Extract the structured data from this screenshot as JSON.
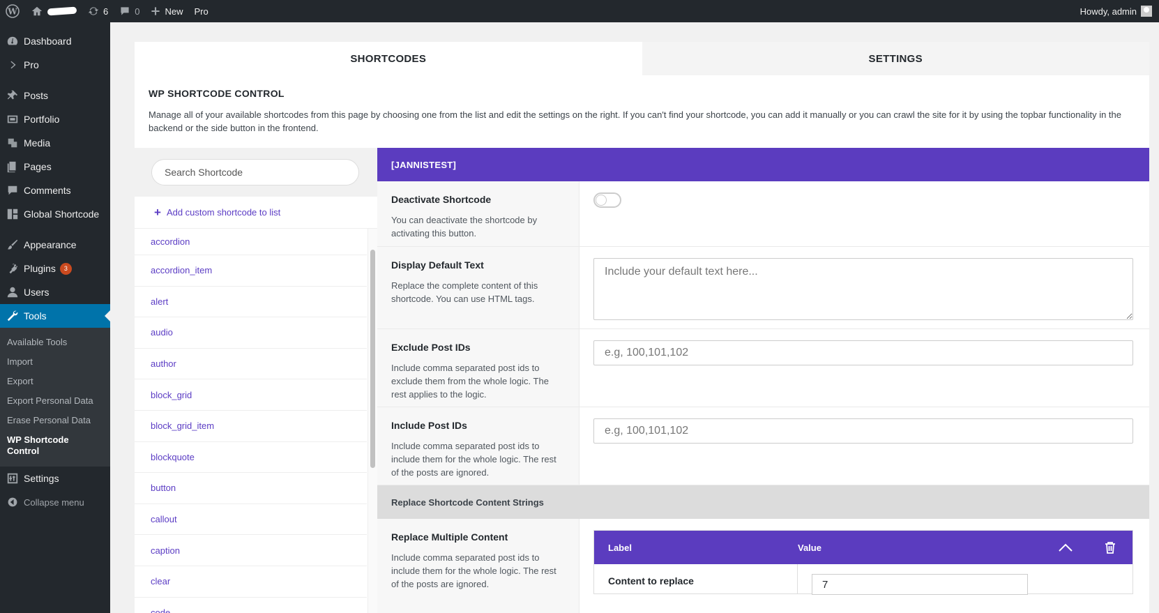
{
  "adminbar": {
    "updates_count": "6",
    "comments_count": "0",
    "new_label": "New",
    "pro_label": "Pro",
    "howdy": "Howdy, admin"
  },
  "sidebar": {
    "items": [
      {
        "label": "Dashboard",
        "icon": "dashboard-icon"
      },
      {
        "label": "Pro",
        "icon": "chevron-right-icon"
      },
      {
        "label": "Posts",
        "icon": "pin-icon"
      },
      {
        "label": "Portfolio",
        "icon": "portfolio-icon"
      },
      {
        "label": "Media",
        "icon": "media-icon"
      },
      {
        "label": "Pages",
        "icon": "pages-icon"
      },
      {
        "label": "Comments",
        "icon": "comment-icon"
      },
      {
        "label": "Global Shortcode",
        "icon": "grid-icon"
      },
      {
        "label": "Appearance",
        "icon": "brush-icon"
      },
      {
        "label": "Plugins",
        "icon": "plugin-icon",
        "badge": "3"
      },
      {
        "label": "Users",
        "icon": "user-icon"
      },
      {
        "label": "Tools",
        "icon": "wrench-icon"
      },
      {
        "label": "Settings",
        "icon": "settings-icon"
      },
      {
        "label": "Collapse menu",
        "icon": "collapse-icon"
      }
    ],
    "tools_submenu": [
      "Available Tools",
      "Import",
      "Export",
      "Export Personal Data",
      "Erase Personal Data",
      "WP Shortcode Control"
    ]
  },
  "tabs": [
    "SHORTCODES",
    "SETTINGS"
  ],
  "intro": {
    "title": "WP SHORTCODE CONTROL",
    "description": "Manage all of your available shortcodes from this page by choosing one from the list and edit the settings on the right. If you can't find your shortcode, you can add it manually or you can crawl the site for it by using the topbar functionality in the backend or the side button in the frontend."
  },
  "search": {
    "placeholder": "Search Shortcode"
  },
  "add_custom_label": "Add custom shortcode to list",
  "shortcodes": [
    "accordion",
    "accordion_item",
    "alert",
    "audio",
    "author",
    "block_grid",
    "block_grid_item",
    "blockquote",
    "button",
    "callout",
    "caption",
    "clear",
    "code"
  ],
  "selected": {
    "header": "[JANNISTEST]",
    "deactivate": {
      "title": "Deactivate Shortcode",
      "desc": "You can deactivate the shortcode by activating this button."
    },
    "default_text": {
      "title": "Display Default Text",
      "desc": "Replace the complete content of this shortcode. You can use HTML tags.",
      "placeholder": "Include your default text here..."
    },
    "exclude": {
      "title": "Exclude Post IDs",
      "desc": "Include comma separated post ids to exclude them from the whole logic. The rest applies to the logic.",
      "placeholder": "e.g, 100,101,102"
    },
    "include": {
      "title": "Include Post IDs",
      "desc": "Include comma separated post ids to include them for the whole logic. The rest of the posts are ignored.",
      "placeholder": "e.g, 100,101,102"
    },
    "group_title": "Replace Shortcode Content Strings",
    "replace_multiple": {
      "title": "Replace Multiple Content",
      "desc": "Include comma separated post ids to include them for the whole logic. The rest of the posts are ignored.",
      "col_label": "Label",
      "col_value": "Value",
      "row_label": "Content to replace",
      "row_value": "7"
    }
  },
  "colors": {
    "accent": "#5b3cbf",
    "admin_dark": "#23282d",
    "active_blue": "#0073aa"
  }
}
